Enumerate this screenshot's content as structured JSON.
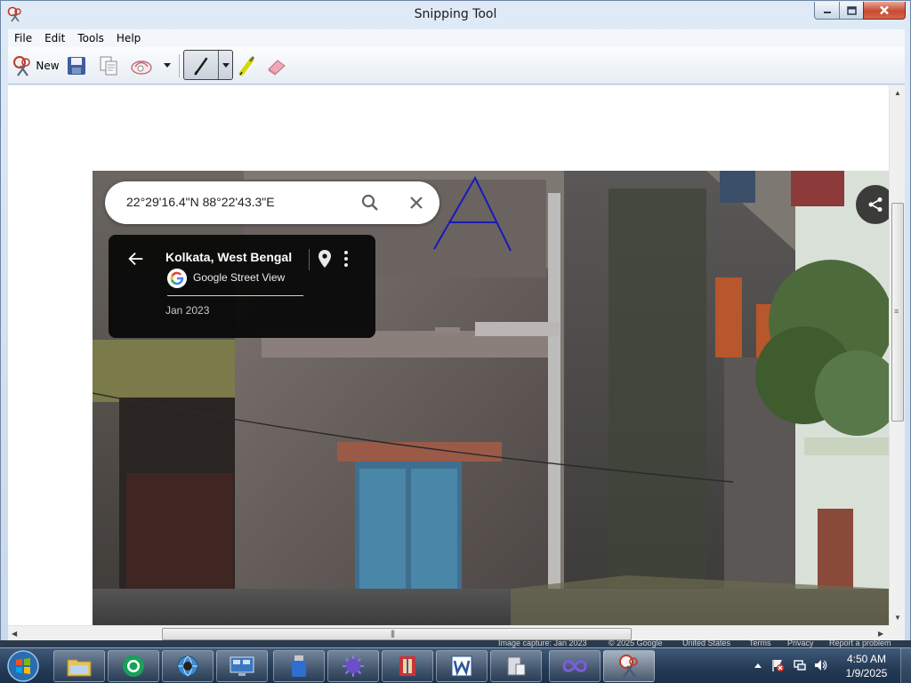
{
  "window": {
    "title": "Snipping Tool"
  },
  "menu": [
    "File",
    "Edit",
    "Tools",
    "Help"
  ],
  "toolbar": {
    "new_label": "New",
    "icons": [
      "new-snip-icon",
      "save-icon",
      "copy-icon",
      "send-snip-icon",
      "dropdown-arrow-icon",
      "pen-icon",
      "highlighter-icon",
      "eraser-icon"
    ]
  },
  "snip": {
    "search_text": "22°29'16.4\"N 88°22'43.3\"E",
    "place_title": "Kolkata, West Bengal",
    "source_label": "Google Street View",
    "capture_date": "Jan 2023",
    "footer": {
      "image_capture": "Image capture: Jan 2023",
      "copyright": "© 2025 Google",
      "country": "United States",
      "terms": "Terms",
      "privacy": "Privacy",
      "report": "Report a problem"
    }
  },
  "taskbar": {
    "apps": [
      "windows-explorer-icon",
      "chrome-icon",
      "network-icon",
      "remote-desktop-icon",
      "usb-drive-icon",
      "virus-icon",
      "archive-icon",
      "word-icon",
      "device-icon",
      "infinity-icon",
      "snipping-tool-icon"
    ],
    "time": "4:50 AM",
    "date": "1/9/2025"
  },
  "colors": {
    "accent": "#3e6ea7",
    "close": "#c74a33",
    "pen_ink": "#1a1ab8"
  }
}
